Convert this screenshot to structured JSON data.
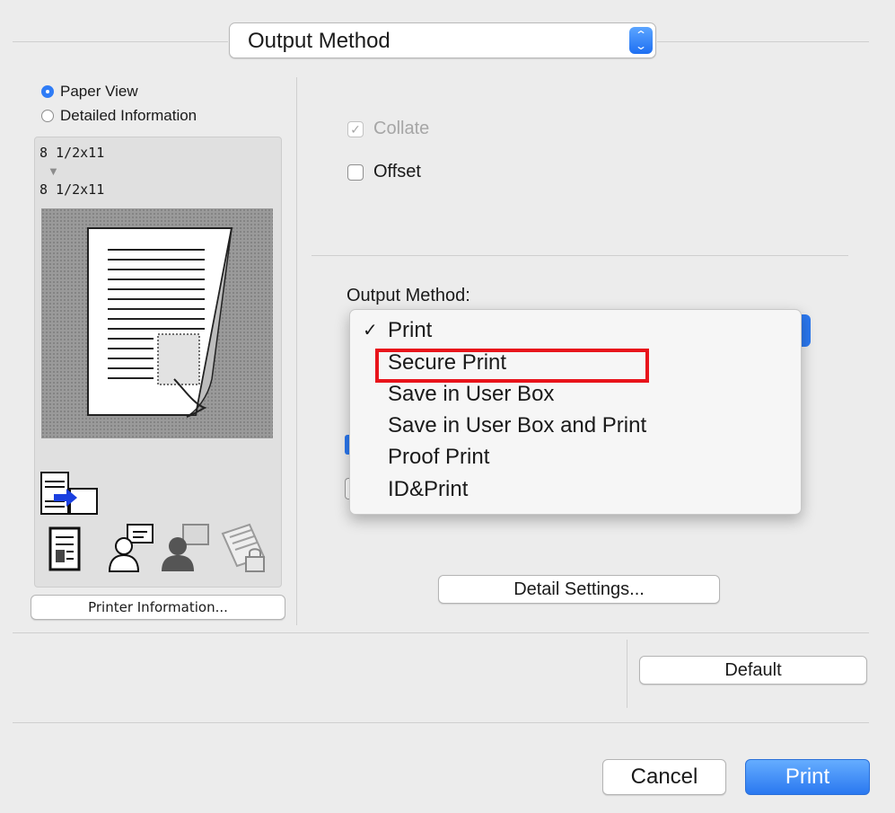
{
  "header": {
    "panel_popup": "Output Method"
  },
  "preview": {
    "radio_paper_view": "Paper View",
    "radio_detailed": "Detailed Information",
    "paper_from": "8 1/2x11",
    "paper_arrow": "▼",
    "paper_to": "8 1/2x11",
    "printer_info_button": "Printer Information..."
  },
  "options": {
    "collate_label": "Collate",
    "offset_label": "Offset",
    "output_method_label": "Output Method:"
  },
  "menu": {
    "selected_check": "✓",
    "items": [
      "Print",
      "Secure Print",
      "Save in User Box",
      "Save in User Box and Print",
      "Proof Print",
      "ID&Print"
    ],
    "highlighted": "Secure Print"
  },
  "buttons": {
    "detail_settings": "Detail Settings...",
    "default": "Default",
    "cancel": "Cancel",
    "print": "Print"
  },
  "colors": {
    "accent": "#2f7cf6",
    "highlight_frame": "#e8141b"
  }
}
